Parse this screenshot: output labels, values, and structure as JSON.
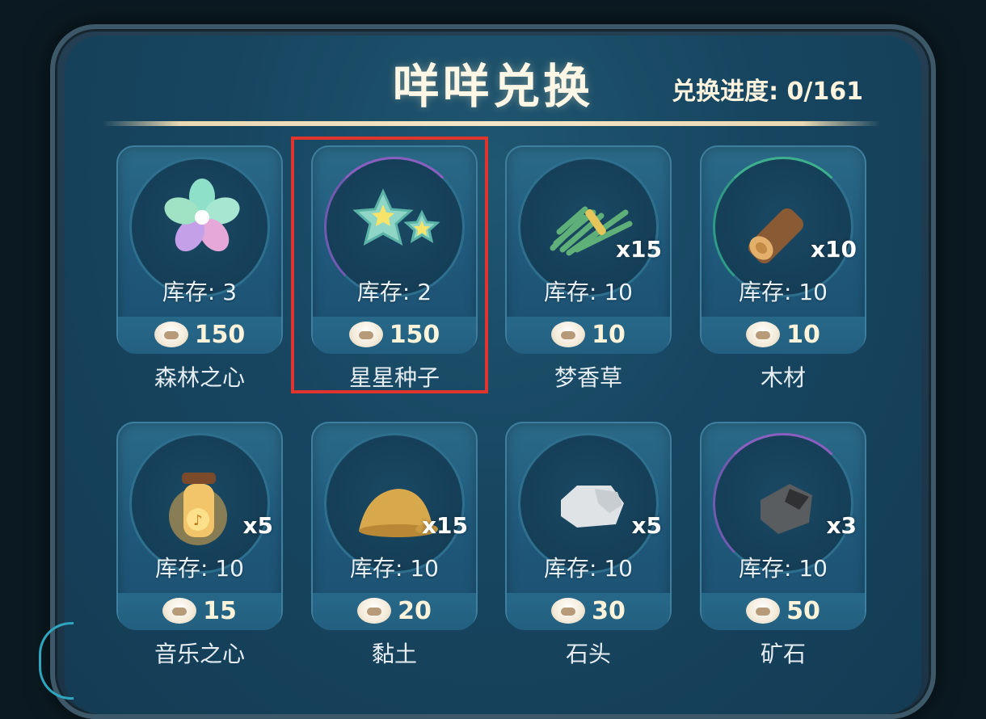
{
  "header": {
    "title": "咩咩兑换",
    "progress_label": "兑换进度:",
    "progress_value": "0/161"
  },
  "items": [
    {
      "name": "森林之心",
      "stock": "库存: 3",
      "price": "150",
      "multiplier": "",
      "icon": "flower-icon"
    },
    {
      "name": "星星种子",
      "stock": "库存: 2",
      "price": "150",
      "multiplier": "",
      "icon": "star-seed-icon"
    },
    {
      "name": "梦香草",
      "stock": "库存: 10",
      "price": "10",
      "multiplier": "x15",
      "icon": "grass-bundle-icon"
    },
    {
      "name": "木材",
      "stock": "库存: 10",
      "price": "10",
      "multiplier": "x10",
      "icon": "wood-log-icon"
    },
    {
      "name": "音乐之心",
      "stock": "库存: 10",
      "price": "15",
      "multiplier": "x5",
      "icon": "music-jar-icon"
    },
    {
      "name": "黏土",
      "stock": "库存: 10",
      "price": "20",
      "multiplier": "x15",
      "icon": "clay-pile-icon"
    },
    {
      "name": "石头",
      "stock": "库存: 10",
      "price": "30",
      "multiplier": "x5",
      "icon": "stone-icon"
    },
    {
      "name": "矿石",
      "stock": "库存: 10",
      "price": "50",
      "multiplier": "x3",
      "icon": "ore-icon"
    }
  ],
  "currency_icon": "sheep-icon",
  "colors": {
    "highlight": "#e0352f",
    "title": "#fff7e6",
    "panel": "#1f5670"
  }
}
